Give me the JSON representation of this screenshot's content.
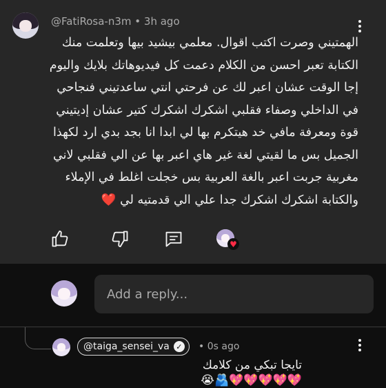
{
  "comment": {
    "author": "@FatiRosa-n3m",
    "separator": "•",
    "time": "3h ago",
    "lines": [
      "الهمتيني وصرت اكتب اقوال. معلمي بيشيد بيها وتعلمت منك",
      "الكتابة تعبر احسن من الكلام دعمت كل فيديوهاتك بلايك واليوم",
      "إجا الوقت عشان اعبر لك عن فرحتي انتي ساعدتيني فنجاحي",
      "في الداخلي وصفاء فقلبي  اشكرك اشكرك كتير عشان إديتيني",
      "قوة ومعرفة مافي خد هيتكرم بها لي ابدا انا بجد بدي ارد لكهذا",
      "الجميل بس ما لقيتي لغة غير هاي اعبر بها عن الي فقلبي لاني",
      "مغربية  جربت اعبر بالغة العربية بس خجلت اغلط في الإملاء",
      "والكتابة اشكرك اشكرك جدا علي الي قدمتيه لي"
    ],
    "heart_emoji": "❤️",
    "icons": {
      "like": "thumbs-up-icon",
      "dislike": "thumbs-down-icon",
      "reply": "comment-icon",
      "menu": "more-vert-icon"
    }
  },
  "reply_box": {
    "placeholder": "Add a reply..."
  },
  "reply": {
    "author": "@taiga_sensei_va",
    "verified_glyph": "✓",
    "separator": "•",
    "time": "0s ago",
    "line1": "تايجا تبكي من كلامك",
    "line2": "💖💖💖💖💖🫂😭"
  },
  "colors": {
    "background": "#0f0f0f",
    "comment_bg": "#272727",
    "text": "#f1f1f1",
    "secondary_text": "#aaaaaa",
    "creator_heart": "#ff2b45"
  }
}
